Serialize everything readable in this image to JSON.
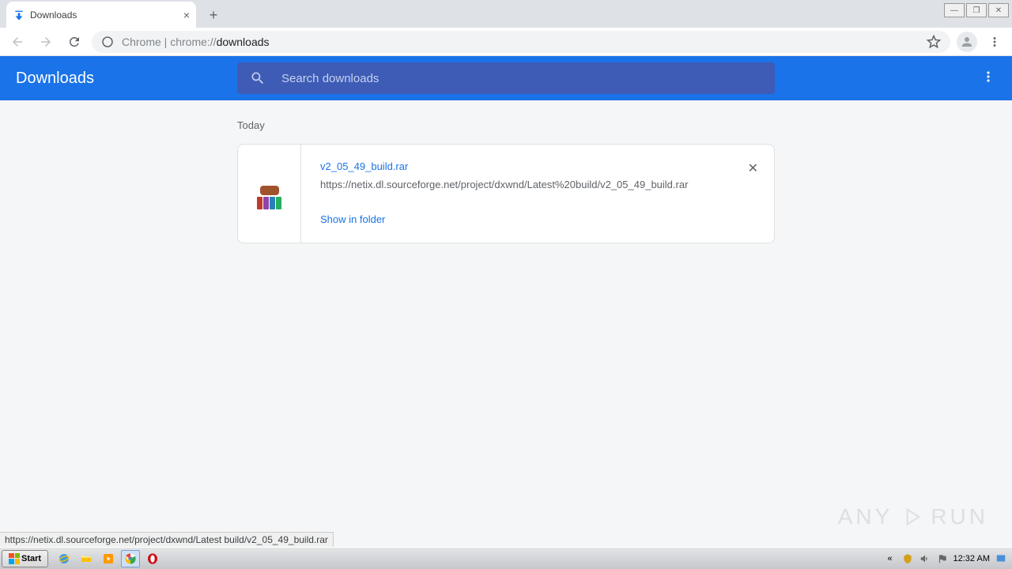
{
  "tab": {
    "title": "Downloads"
  },
  "omnibox": {
    "label": "Chrome",
    "url_prefix": "chrome://",
    "url_highlight": "downloads"
  },
  "header": {
    "title": "Downloads",
    "search_placeholder": "Search downloads"
  },
  "section": {
    "label": "Today"
  },
  "download": {
    "filename": "v2_05_49_build.rar",
    "url": "https://netix.dl.sourceforge.net/project/dxwnd/Latest%20build/v2_05_49_build.rar",
    "show_in_folder": "Show in folder"
  },
  "status_bar": {
    "text": "https://netix.dl.sourceforge.net/project/dxwnd/Latest build/v2_05_49_build.rar"
  },
  "taskbar": {
    "start": "Start",
    "clock": "12:32 AM"
  },
  "watermark": {
    "left": "ANY",
    "right": "RUN"
  }
}
